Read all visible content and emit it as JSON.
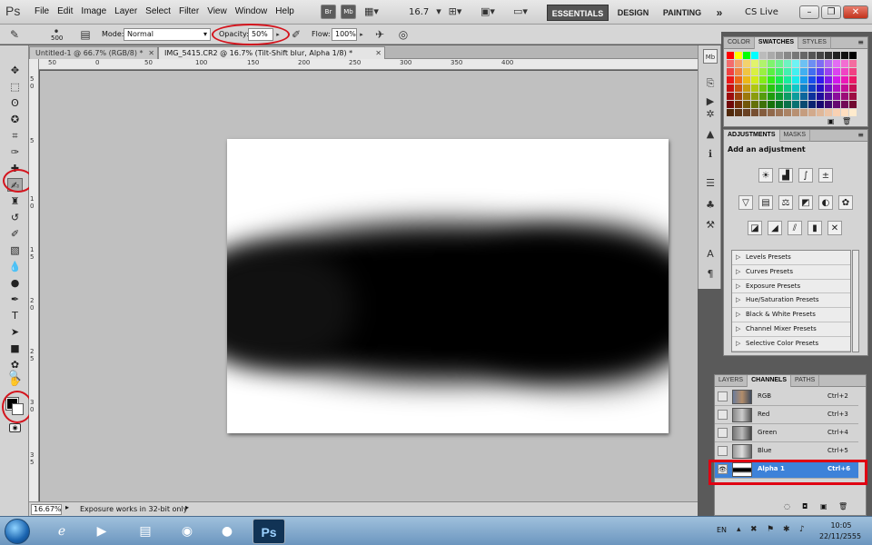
{
  "app": {
    "logo": "Ps",
    "menu": [
      "File",
      "Edit",
      "Image",
      "Layer",
      "Select",
      "Filter",
      "View",
      "Window",
      "Help"
    ],
    "bridge_label": "Br",
    "minibridge_label": "Mb",
    "zoom_level": "16.7",
    "workspaces": [
      "ESSENTIALS",
      "DESIGN",
      "PAINTING"
    ],
    "more": "»",
    "cs_live": "CS Live"
  },
  "options": {
    "brush_size": "500",
    "mode_label": "Mode:",
    "mode_value": "Normal",
    "opacity_label": "Opacity:",
    "opacity_value": "50%",
    "flow_label": "Flow:",
    "flow_value": "100%"
  },
  "tabs": [
    {
      "label": "Untitled-1 @ 66.7% (RGB/8) *"
    },
    {
      "label": "IMG_5415.CR2 @ 16.7% (Tilt-Shift blur, Alpha 1/8) *"
    }
  ],
  "ruler": {
    "h": [
      "50",
      "0",
      "50",
      "100",
      "150",
      "200",
      "250",
      "300",
      "350",
      "400"
    ],
    "v": [
      "5",
      "0",
      "5",
      "1",
      "0",
      "1",
      "5",
      "2",
      "0",
      "2",
      "5",
      "3",
      "0",
      "3",
      "5"
    ]
  },
  "status": {
    "zoom": "16.67%",
    "message": "Exposure works in 32-bit only"
  },
  "panels": {
    "color_tabs": [
      "COLOR",
      "SWATCHES",
      "STYLES"
    ],
    "adjust_tabs": [
      "ADJUSTMENTS",
      "MASKS"
    ],
    "add_adjustment": "Add an adjustment",
    "presets": [
      "Levels Presets",
      "Curves Presets",
      "Exposure Presets",
      "Hue/Saturation Presets",
      "Black & White Presets",
      "Channel Mixer Presets",
      "Selective Color Presets"
    ],
    "layer_tabs": [
      "LAYERS",
      "CHANNELS",
      "PATHS"
    ],
    "channels": [
      {
        "name": "RGB",
        "key": "Ctrl+2"
      },
      {
        "name": "Red",
        "key": "Ctrl+3"
      },
      {
        "name": "Green",
        "key": "Ctrl+4"
      },
      {
        "name": "Blue",
        "key": "Ctrl+5"
      },
      {
        "name": "Alpha 1",
        "key": "Ctrl+6"
      }
    ]
  },
  "taskbar": {
    "lang": "EN",
    "time": "10:05",
    "date": "22/11/2555",
    "ps_label": "Ps"
  },
  "colors": {
    "selection_blue": "#3d82d9",
    "highlight_red": "#e00012",
    "essentials_bg": "#555555"
  }
}
